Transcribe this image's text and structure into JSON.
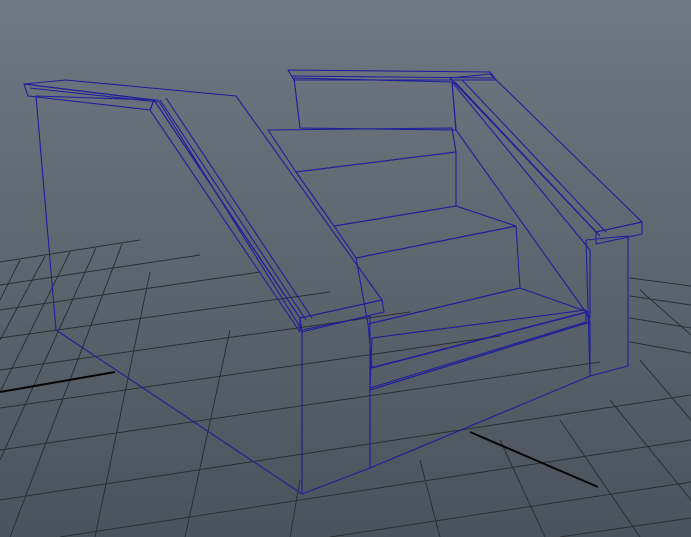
{
  "viewport": {
    "view": "perspective",
    "grid_visible": true,
    "object_selected": true,
    "selection_color": "#1e1e9a"
  },
  "colors": {
    "background_top": "#6f7882",
    "background_bottom": "#4a525b",
    "grid_line": "#2b2f34",
    "axis_line": "#050505",
    "surface_light": "#6a6a6a",
    "surface_mid": "#4e4e4e",
    "surface_dark": "#2a2a2a"
  }
}
